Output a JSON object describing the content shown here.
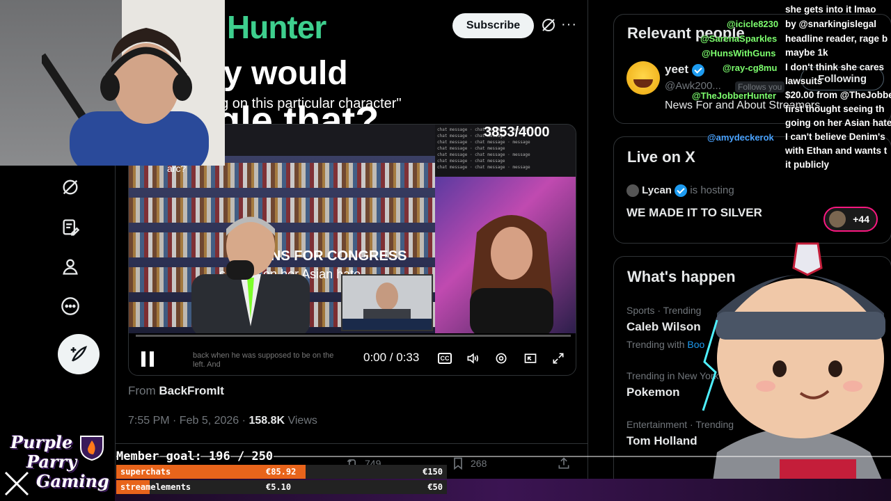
{
  "post": {
    "brand": "Hunter",
    "headline_1": "y would",
    "quote": "ng on this particular character\"",
    "headline_2": "gle that?",
    "ribbon": "RUNS FOR CONGRESS",
    "subtext": "s going on her Asian hate",
    "subtext2": "arc?",
    "subscribe_label": "Subscribe",
    "from_prefix": "From",
    "from_account": "BackFromIt",
    "timestamp": "7:55 PM · Feb 5, 2026 ·",
    "views_count": "158.8K",
    "views_label": "Views",
    "replies": "",
    "reposts": "749",
    "likes": "268"
  },
  "video": {
    "counter": "3853/4000",
    "caption": "back when he was supposed to be on the left. And",
    "timecode": "0:00 / 0:33",
    "cc_label": "CC",
    "progress": 0.0
  },
  "sidebar": {
    "relevant_title": "Relevant people",
    "person_name": "yeet",
    "person_handle": "@Awk200...",
    "follows_you": "Follows you",
    "follow_label": "Following",
    "person_bio": "News For and About Streamers",
    "live_title": "Live on X",
    "live_host": "Lycan",
    "live_hosting": "is hosting",
    "live_stream_title": "WE MADE IT TO SILVER",
    "live_count": "+44",
    "happening_title": "What's happen",
    "trends": [
      {
        "category": "Sports · Trending",
        "name": "Caleb Wilson",
        "extra": "Trending with ",
        "extra_link": "Boo"
      },
      {
        "category": "Trending in New York",
        "name": "Pokemon",
        "extra": "",
        "extra_link": ""
      },
      {
        "category": "Entertainment · Trending",
        "name": "Tom Holland",
        "extra": "",
        "extra_link": ""
      }
    ]
  },
  "stream_chat": {
    "users": [
      "@icicle8230",
      "@SarenaSparkles",
      "@HunsWithGuns",
      "@ray-cg8mu",
      "@TheJobberHunter",
      "@amydeckerok"
    ],
    "messages": [
      "she gets into it lmao",
      "by @snarkingislegal",
      "headline reader, rage b",
      "maybe 1k",
      "I don't think she cares",
      "lawsuits",
      "$20.00 from @TheJobbe",
      "first thought seeing th",
      "going on her Asian hate",
      "I can't believe Denim's",
      "with Ethan and wants t",
      "it publicly"
    ]
  },
  "overlay": {
    "brand_line1": "Purple",
    "brand_line2": "Parry",
    "brand_line3": "Gaming",
    "member_goal": "Member goal: 196 / 250",
    "donations": [
      {
        "label": "superchats",
        "amount": "€85.92",
        "target": "€150",
        "fraction": 0.573
      },
      {
        "label": "streamelements",
        "amount": "€5.10",
        "target": "€50",
        "fraction": 0.102
      }
    ]
  },
  "colors": {
    "accent": "#1d9bf0",
    "brand_green": "#3ecf8e",
    "donation_fill": "#e8641b",
    "chat_user": "#7dff6e"
  },
  "icons": {
    "nav": [
      "grok-icon",
      "lists-icon",
      "profile-icon",
      "more-circle-icon"
    ],
    "post": "compose-feather-icon"
  }
}
